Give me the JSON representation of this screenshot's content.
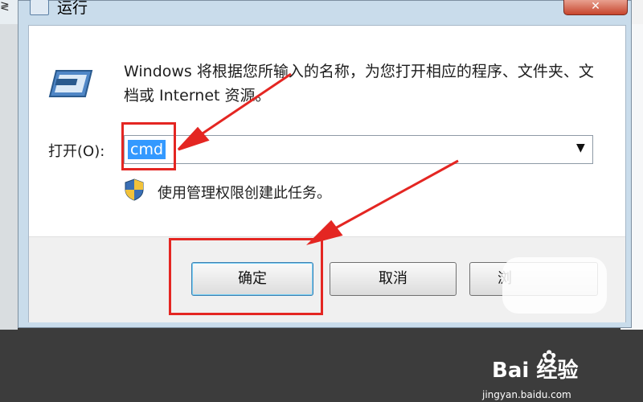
{
  "window": {
    "title": "运行",
    "close_glyph": "✕"
  },
  "dialog": {
    "description": "Windows 将根据您所输入的名称，为您打开相应的程序、文件夹、文档或 Internet 资源。",
    "open_label": "打开(O):",
    "command_value": "cmd",
    "admin_note": "使用管理权限创建此任务。"
  },
  "buttons": {
    "ok": "确定",
    "cancel": "取消",
    "browse": "浏"
  },
  "icons": {
    "run": "run-dialog-icon",
    "shield": "uac-shield-icon",
    "dropdown": "chevron-down-icon"
  },
  "annotations": {
    "color": "#e42622"
  },
  "watermark": {
    "brand": "Bai  经验",
    "url": "jingyan.baidu.com"
  },
  "background": {
    "left_glyph": "≷"
  }
}
